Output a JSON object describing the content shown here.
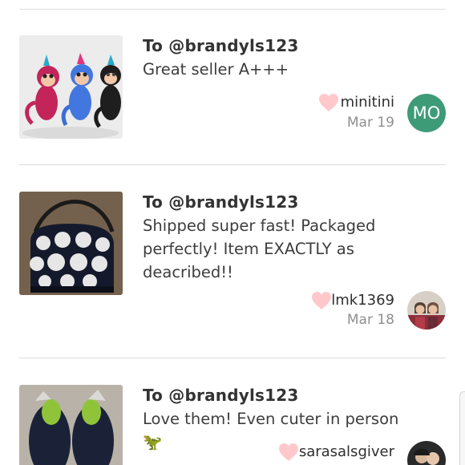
{
  "colors": {
    "heart": "#ffc9cc",
    "avatar_mo": "#3e9b78",
    "divider": "#dcdcdc",
    "username": "#2f2f2f",
    "date": "#8f8f8f"
  },
  "comments": [
    {
      "to": "To @brandyls123",
      "text": "Great seller A+++",
      "username": "minitini",
      "date": "Mar 19",
      "avatar_initials": "MO",
      "thumbnail": "monkey-toys-photo",
      "icon": "heart-icon"
    },
    {
      "to": "To @brandyls123",
      "text": "Shipped super fast! Packaged perfectly! Item EXACTLY as deacribed!!",
      "username": "lmk1369",
      "date": "Mar 18",
      "avatar": "profile-photo",
      "thumbnail": "polka-dot-bag-photo",
      "icon": "heart-icon"
    },
    {
      "to": "To @brandyls123",
      "text": "Love them! Even cuter in person 🦖",
      "username": "sarasalsgiver",
      "avatar": "profile-photo",
      "thumbnail": "slippers-photo",
      "icon": "heart-icon"
    }
  ]
}
